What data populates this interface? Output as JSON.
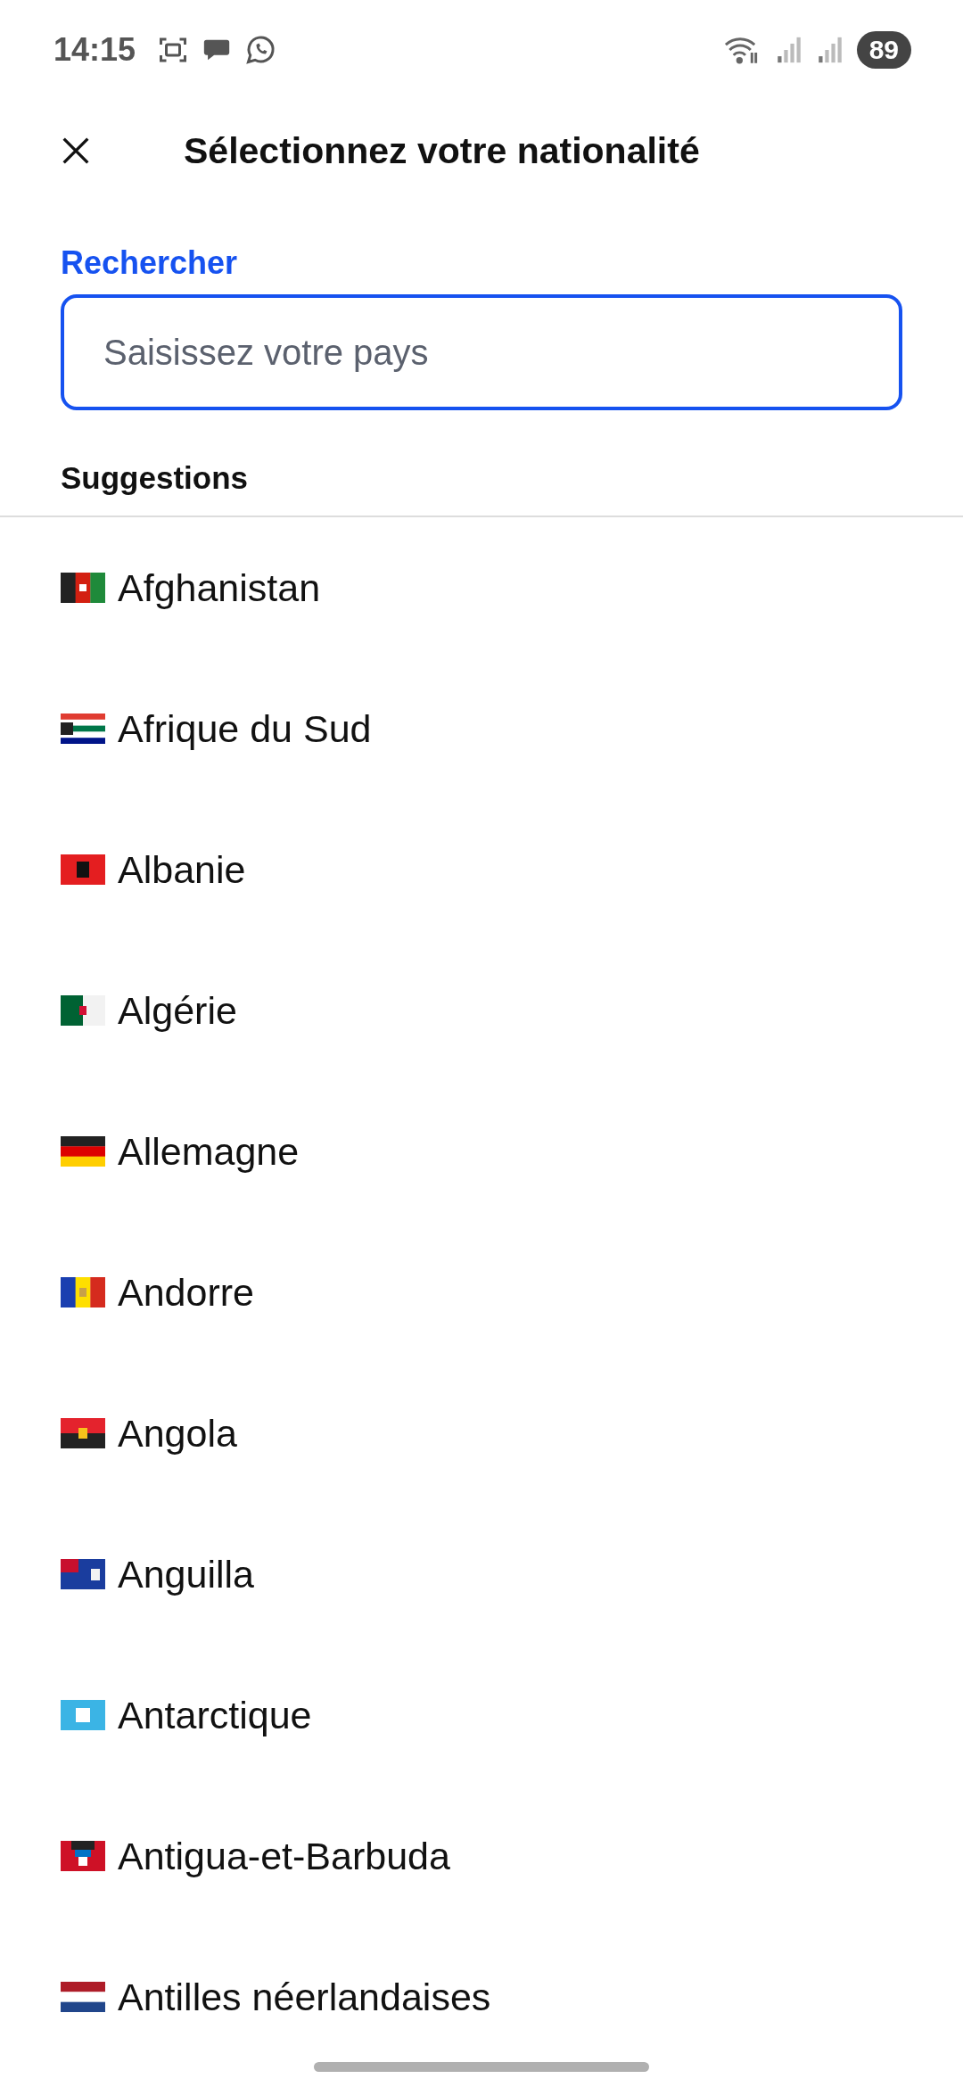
{
  "status_bar": {
    "time": "14:15",
    "battery": "89"
  },
  "header": {
    "title": "Sélectionnez votre nationalité"
  },
  "search": {
    "label": "Rechercher",
    "placeholder": "Saisissez votre pays"
  },
  "section_title": "Suggestions",
  "countries": [
    {
      "name": "Afghanistan",
      "kind": "af"
    },
    {
      "name": "Afrique du Sud",
      "kind": "za"
    },
    {
      "name": "Albanie",
      "kind": "al"
    },
    {
      "name": "Algérie",
      "kind": "dz"
    },
    {
      "name": "Allemagne",
      "kind": "de"
    },
    {
      "name": "Andorre",
      "kind": "ad"
    },
    {
      "name": "Angola",
      "kind": "ao"
    },
    {
      "name": "Anguilla",
      "kind": "ai"
    },
    {
      "name": "Antarctique",
      "kind": "aq"
    },
    {
      "name": "Antigua-et-Barbuda",
      "kind": "ag"
    },
    {
      "name": "Antilles néerlandaises",
      "kind": "an"
    }
  ]
}
